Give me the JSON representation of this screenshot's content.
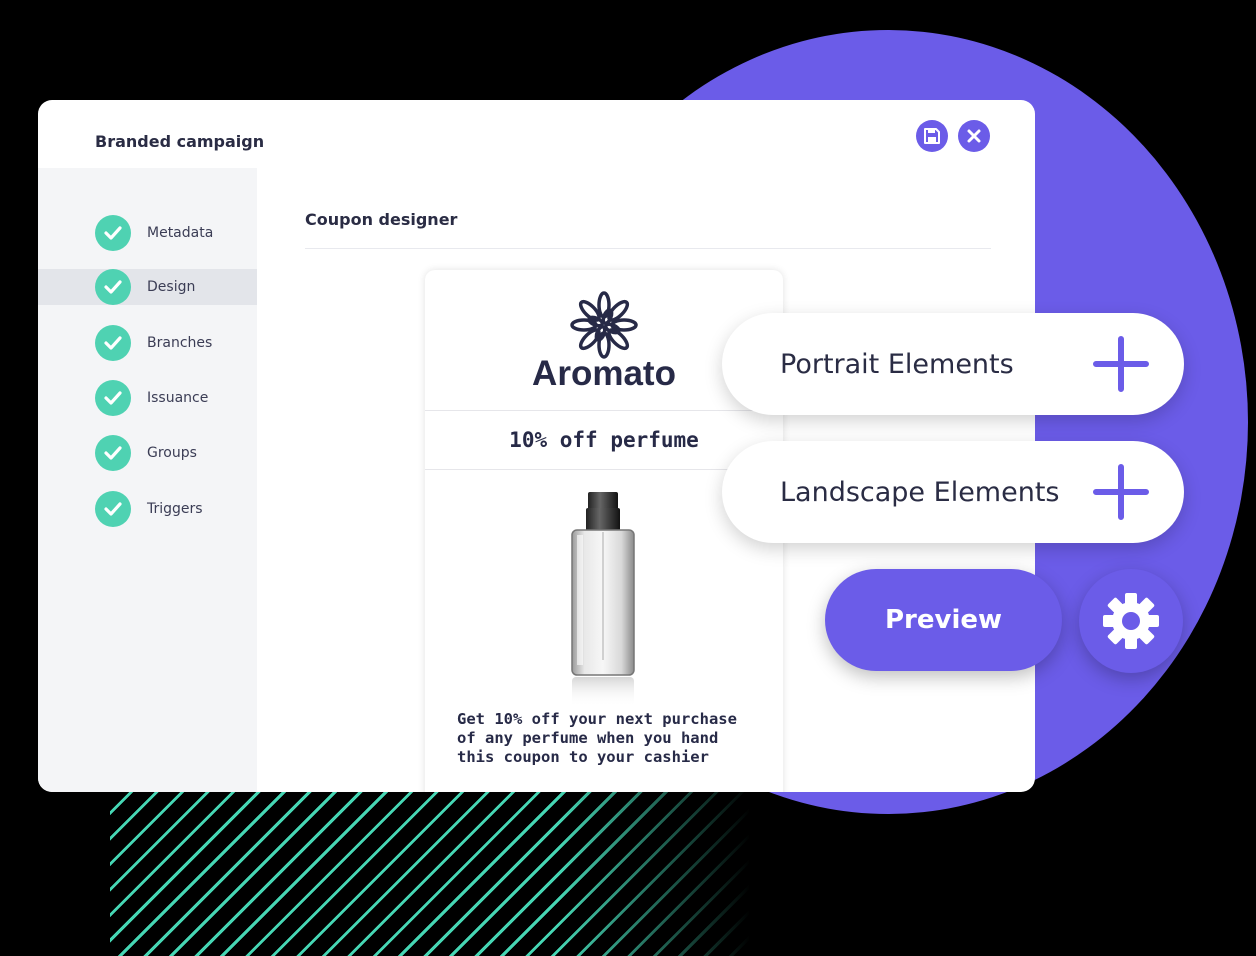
{
  "window": {
    "title": "Branded campaign",
    "save_icon": "save-icon",
    "close_icon": "close-icon"
  },
  "sidebar": {
    "steps": [
      {
        "label": "Metadata",
        "completed": true
      },
      {
        "label": "Design",
        "completed": true,
        "active": true
      },
      {
        "label": "Branches",
        "completed": true
      },
      {
        "label": "Issuance",
        "completed": true
      },
      {
        "label": "Groups",
        "completed": true
      },
      {
        "label": "Triggers",
        "completed": true
      }
    ]
  },
  "main": {
    "section_title": "Coupon designer",
    "coupon": {
      "brand_name": "Aromato",
      "offer": "10% off perfume",
      "description": "Get 10% off your next purchase of any perfume when you hand this coupon to your cashier"
    }
  },
  "actions": {
    "portrait_label": "Portrait Elements",
    "landscape_label": "Landscape Elements",
    "preview_label": "Preview",
    "settings_icon": "gear-icon"
  },
  "colors": {
    "accent": "#6b5ce8",
    "check": "#4fd2b2",
    "text": "#2a2c44"
  }
}
